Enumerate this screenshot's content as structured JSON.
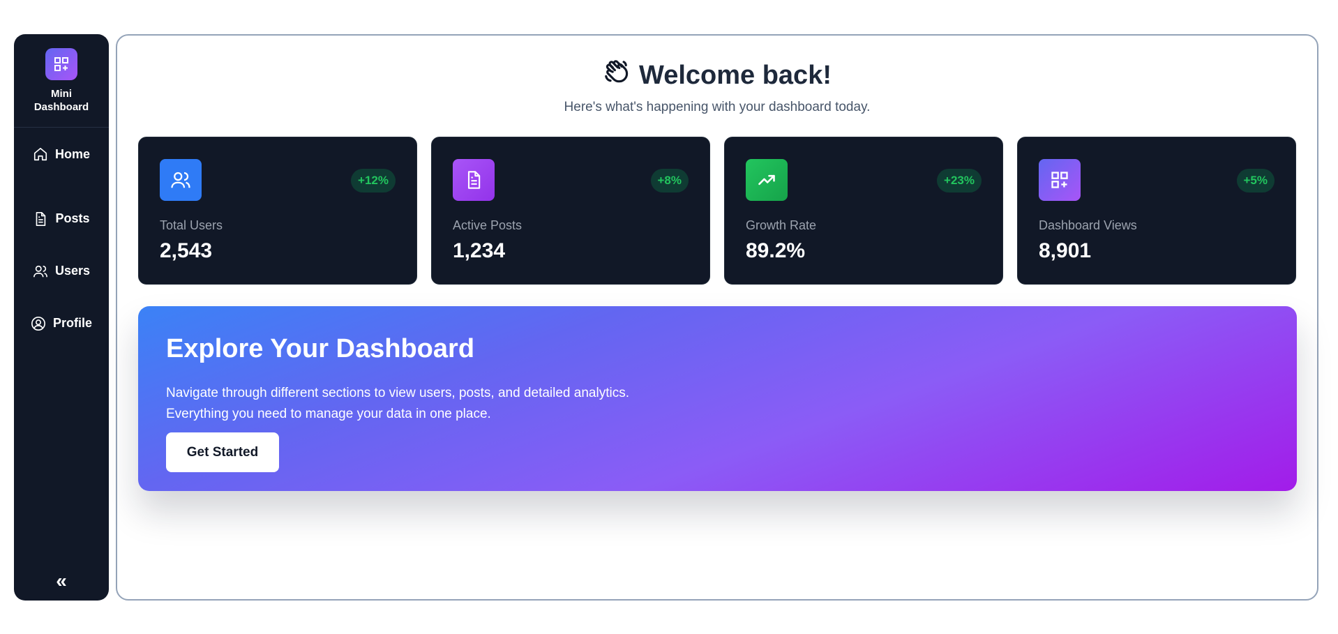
{
  "sidebar": {
    "brand": "Mini Dashboard",
    "items": [
      {
        "label": "Home",
        "icon": "home-icon"
      },
      {
        "label": "Posts",
        "icon": "document-icon"
      },
      {
        "label": "Users",
        "icon": "users-icon"
      },
      {
        "label": "Profile",
        "icon": "user-circle-icon"
      }
    ],
    "collapse_label": "«"
  },
  "header": {
    "title": "Welcome back!",
    "subtitle": "Here's what's happening with your dashboard today."
  },
  "stats": [
    {
      "label": "Total Users",
      "value": "2,543",
      "change": "+12%",
      "icon": "users-icon",
      "color": "#3b82f6"
    },
    {
      "label": "Active Posts",
      "value": "1,234",
      "change": "+8%",
      "icon": "document-icon",
      "color": "#a855f7"
    },
    {
      "label": "Growth Rate",
      "value": "89.2%",
      "change": "+23%",
      "icon": "trending-up-icon",
      "color": "#16a34a"
    },
    {
      "label": "Dashboard Views",
      "value": "8,901",
      "change": "+5%",
      "icon": "grid-plus-icon",
      "color": "#8b5cf6"
    }
  ],
  "banner": {
    "title": "Explore Your Dashboard",
    "line1": "Navigate through different sections to view users, posts, and detailed analytics.",
    "line2": "Everything you need to manage your data in one place.",
    "button": "Get Started"
  }
}
